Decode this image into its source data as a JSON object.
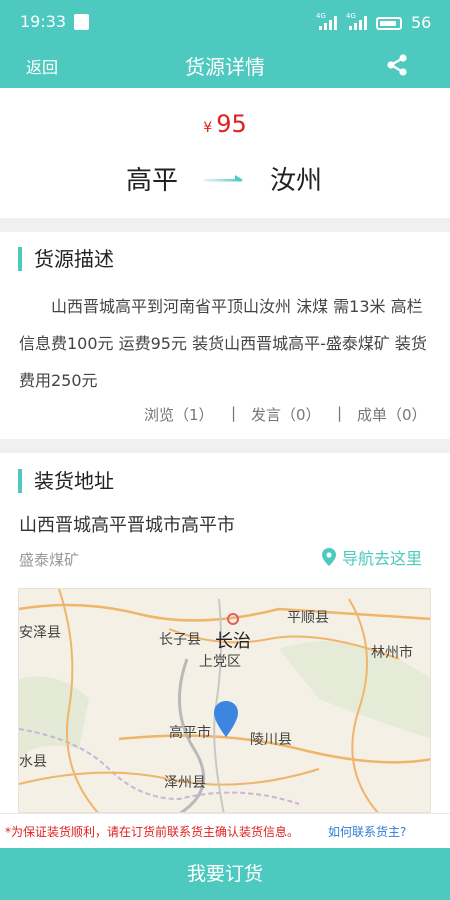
{
  "status_bar": {
    "time": "19:33",
    "network_1": "4G",
    "network_2": "4G",
    "battery": "56"
  },
  "header": {
    "back_label": "返回",
    "title": "货源详情",
    "share_icon": "share-icon"
  },
  "cargo": {
    "currency": "¥",
    "price": "95",
    "origin": "高平",
    "destination": "汝州"
  },
  "description": {
    "section_title": "货源描述",
    "text": "山西晋城高平到河南省平顶山汝州 沫煤 需13米 高栏 信息费100元 运费95元 装货山西晋城高平-盛泰煤矿 装货费用250元",
    "stats": {
      "views": "浏览（1）",
      "sep1": "|",
      "comments": "发言（0）",
      "sep2": "|",
      "deals": "成单（0）"
    }
  },
  "loading": {
    "section_title": "装货地址",
    "address": "山西晋城高平晋城市高平市",
    "site_name": "盛泰煤矿",
    "navigate_label": "导航去这里",
    "map_labels": {
      "anze": "安泽县",
      "zhangzi": "长子县",
      "changzhi": "长治",
      "shangdang": "上党区",
      "pingshun": "平顺县",
      "linzhou": "林州市",
      "gaoping": "高平市",
      "lingchuan": "陵川县",
      "shuixian": "水县",
      "zezhou": "泽州县"
    }
  },
  "notice": {
    "warning": "*为保证装货顺利，请在订货前联系货主确认装货信息。",
    "help_link": "如何联系货主?"
  },
  "action": {
    "order_label": "我要订货"
  },
  "colors": {
    "accent": "#4ec9c0",
    "price": "#e02020",
    "link": "#2f7bd6"
  }
}
